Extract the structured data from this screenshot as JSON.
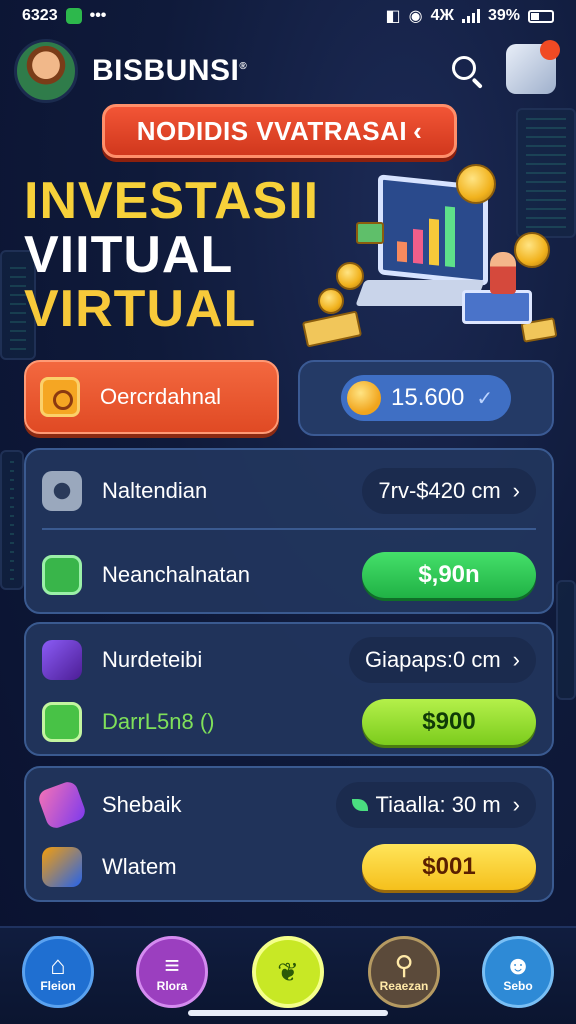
{
  "status_bar": {
    "time": "6323",
    "dots": "•••",
    "network": "4Ж",
    "battery": "39%"
  },
  "header": {
    "app_name": "BISBUNSI",
    "trademark": "®",
    "search_icon": "search-icon",
    "profile_icon": "profile-avatar-icon"
  },
  "promo": {
    "label": "NODIDIS VVATRASAI",
    "arrow": "‹"
  },
  "hero": {
    "line1": "INVESTASII",
    "line2": "VIITUAL",
    "line3": "VIRTUAL"
  },
  "actions": {
    "primary_label": "Oercrdahnal",
    "balance": "15.600",
    "balance_chevron": "✓"
  },
  "cards": [
    {
      "rows": [
        {
          "label": "Naltendian",
          "value": "7rv-$420 cm",
          "chevron": "›",
          "style": "dark",
          "icon": "gear-icon"
        },
        {
          "label": "Neanchalnatan",
          "value": "$,90n",
          "style": "green",
          "icon": "dollar-icon"
        }
      ]
    },
    {
      "rows": [
        {
          "label": "Nurdeteibi",
          "value": "Giapaps:0 cm",
          "chevron": "›",
          "style": "dark",
          "icon": "puzzle-icon"
        },
        {
          "label": "DarrL5n8 ()",
          "value": "$900",
          "style": "lime",
          "icon": "cart-icon"
        }
      ]
    },
    {
      "rows": [
        {
          "label": "Shebaik",
          "value": "Tiaalla: 30 m",
          "chevron": "›",
          "style": "dark",
          "icon": "wand-icon"
        },
        {
          "label": "Wlatem",
          "value": "$001",
          "style": "yellow",
          "icon": "notebook-icon"
        }
      ]
    }
  ],
  "bottom_nav": [
    {
      "label": "Fleion",
      "icon": "home-icon",
      "color": "#1f6fd1"
    },
    {
      "label": "Rlora",
      "icon": "menu-icon",
      "color": "#9b3fbf"
    },
    {
      "label": "",
      "icon": "leaf-icon",
      "color": "#c8e825"
    },
    {
      "label": "Reaezan",
      "icon": "key-icon",
      "color": "#5b4a3a"
    },
    {
      "label": "Sebo",
      "icon": "user-icon",
      "color": "#2e8ad6"
    }
  ]
}
